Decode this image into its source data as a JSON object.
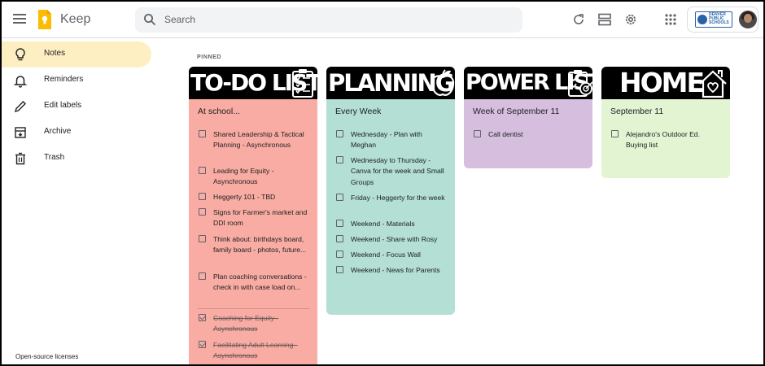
{
  "header": {
    "app_title": "Keep",
    "search_placeholder": "Search"
  },
  "sidebar": {
    "items": [
      {
        "label": "Notes",
        "icon": "lightbulb-icon",
        "active": true
      },
      {
        "label": "Reminders",
        "icon": "bell-icon",
        "active": false
      },
      {
        "label": "Edit labels",
        "icon": "pencil-icon",
        "active": false
      },
      {
        "label": "Archive",
        "icon": "archive-icon",
        "active": false
      },
      {
        "label": "Trash",
        "icon": "trash-icon",
        "active": false
      }
    ],
    "footer_link": "Open-source licenses"
  },
  "main": {
    "section_label": "PINNED",
    "notes": [
      {
        "banner": "TO-DO LIST",
        "banner_icon": "checklist-clipboard-icon",
        "color": "#f9aca3",
        "title": "At school...",
        "items": [
          {
            "text": "Shared Leadership & Tactical Planning - Asynchronous",
            "checked": false
          },
          {
            "text": "Leading for Equity - Asynchronous",
            "checked": false
          },
          {
            "text": "Heggerty 101 - TBD",
            "checked": false
          },
          {
            "text": "Signs for Farmer's market and DDI room",
            "checked": false
          },
          {
            "text": "Think about: birthdays board, family board - photos, future...",
            "checked": false
          },
          {
            "text": "Plan coaching conversations - check in with case load on...",
            "checked": false
          },
          {
            "text": "Coaching for Equity - Asynchronous",
            "checked": true
          },
          {
            "text": "Facilitating Adult Learning - Asynchronous",
            "checked": true
          }
        ]
      },
      {
        "banner": "PLANNING",
        "banner_icon": "apple-icon",
        "color": "#b3dfd4",
        "title": "Every Week",
        "items": [
          {
            "text": "Wednesday - Plan with Meghan",
            "checked": false
          },
          {
            "text": "Wednesday to Thursday - Canva for the week and Small Groups",
            "checked": false
          },
          {
            "text": "Friday - Heggerty for the week",
            "checked": false
          },
          {
            "text": "Weekend - Materials",
            "checked": false
          },
          {
            "text": "Weekend - Share with Rosy",
            "checked": false
          },
          {
            "text": "Weekend - Focus Wall",
            "checked": false
          },
          {
            "text": "Weekend - News for Parents",
            "checked": false
          }
        ]
      },
      {
        "banner": "POWER LIST",
        "banner_icon": "target-clipboard-icon",
        "color": "#d6bedf",
        "title": "Week of September 11",
        "items": [
          {
            "text": "Call dentist",
            "checked": false
          }
        ]
      },
      {
        "banner": "HOME",
        "banner_icon": "house-heart-icon",
        "color": "#e2f4d2",
        "title": "September 11",
        "items": [
          {
            "text": "Alejandro's Outdoor Ed. Buying list",
            "checked": false
          }
        ]
      }
    ]
  },
  "icons": {
    "menu": "menu-icon",
    "logo": "keep-logo-icon",
    "search": "search-icon",
    "refresh": "refresh-icon",
    "list_view": "list-view-icon",
    "settings": "gear-icon",
    "apps": "apps-grid-icon",
    "avatar": "avatar"
  },
  "colors": {
    "active_nav": "#feefc3",
    "keep_yellow": "#fbbc04"
  }
}
